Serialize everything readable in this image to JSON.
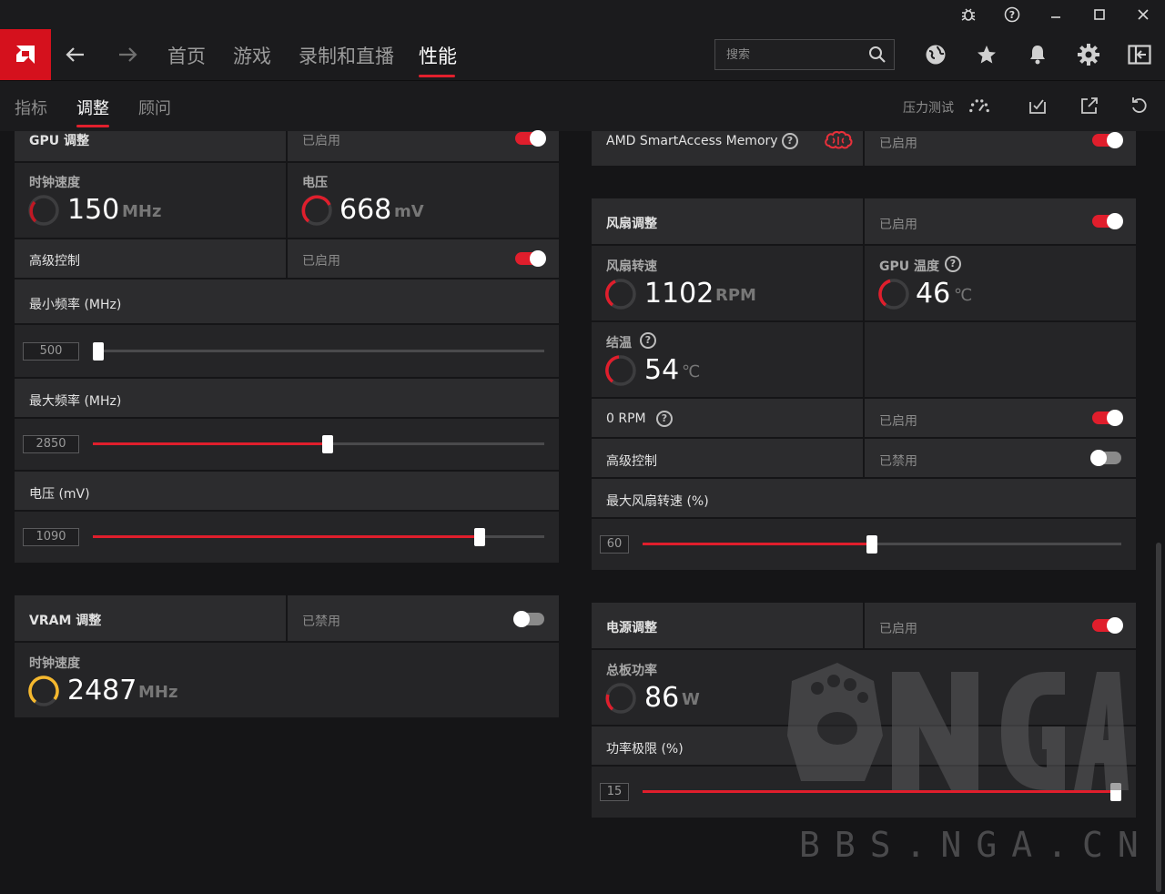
{
  "nav": {
    "tabs": [
      "首页",
      "游戏",
      "录制和直播",
      "性能"
    ],
    "search_placeholder": "搜索"
  },
  "subnav": {
    "tabs": [
      "指标",
      "调整",
      "顾问"
    ],
    "stress_test": "压力测试"
  },
  "gpu": {
    "title": "GPU 调整",
    "status": "已启用",
    "clock_label": "时钟速度",
    "clock_value": "150",
    "clock_unit": "MHz",
    "voltage_label": "电压",
    "voltage_value": "668",
    "voltage_unit": "mV",
    "advanced_label": "高级控制",
    "advanced_status": "已启用",
    "min_freq_label": "最小频率 (MHz)",
    "min_freq_value": "500",
    "max_freq_label": "最大频率 (MHz)",
    "max_freq_value": "2850",
    "volt_label": "电压 (mV)",
    "volt_value": "1090"
  },
  "vram": {
    "title": "VRAM 调整",
    "status": "已禁用",
    "clock_label": "时钟速度",
    "clock_value": "2487",
    "clock_unit": "MHz"
  },
  "sam": {
    "title": "AMD SmartAccess Memory",
    "status": "已启用"
  },
  "fan": {
    "title": "风扇调整",
    "status": "已启用",
    "speed_label": "风扇转速",
    "speed_value": "1102",
    "speed_unit": "RPM",
    "gpu_temp_label": "GPU 温度",
    "gpu_temp_value": "46",
    "temp_unit": "℃",
    "junction_label": "结温",
    "junction_value": "54",
    "zero_rpm_label": "0 RPM",
    "zero_rpm_status": "已启用",
    "advanced_label": "高级控制",
    "advanced_status": "已禁用",
    "max_speed_label": "最大风扇转速 (%)",
    "max_speed_value": "60"
  },
  "power": {
    "title": "电源调整",
    "status": "已启用",
    "board_label": "总板功率",
    "board_value": "86",
    "board_unit": "W",
    "limit_label": "功率极限 (%)",
    "limit_value": "15"
  },
  "watermark": "BBS.NGA.CN",
  "colors": {
    "accent": "#e01e2c",
    "logo": "#d5111d",
    "vram_gauge": "#f5b82e"
  }
}
